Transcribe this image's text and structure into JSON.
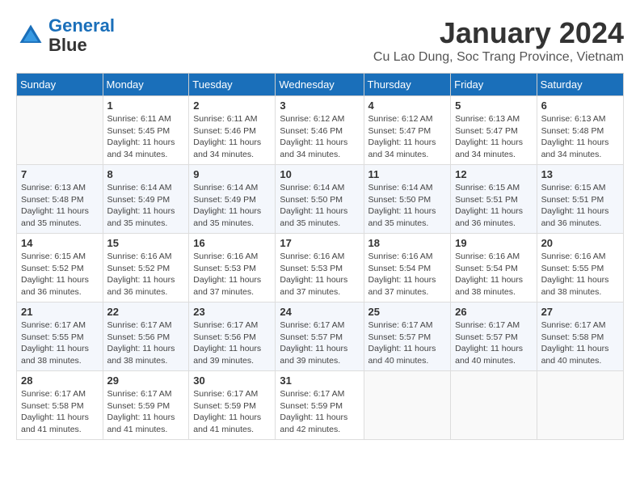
{
  "header": {
    "logo_line1": "General",
    "logo_line2": "Blue",
    "month": "January 2024",
    "location": "Cu Lao Dung, Soc Trang Province, Vietnam"
  },
  "weekdays": [
    "Sunday",
    "Monday",
    "Tuesday",
    "Wednesday",
    "Thursday",
    "Friday",
    "Saturday"
  ],
  "weeks": [
    [
      {
        "day": "",
        "info": ""
      },
      {
        "day": "1",
        "info": "Sunrise: 6:11 AM\nSunset: 5:45 PM\nDaylight: 11 hours\nand 34 minutes."
      },
      {
        "day": "2",
        "info": "Sunrise: 6:11 AM\nSunset: 5:46 PM\nDaylight: 11 hours\nand 34 minutes."
      },
      {
        "day": "3",
        "info": "Sunrise: 6:12 AM\nSunset: 5:46 PM\nDaylight: 11 hours\nand 34 minutes."
      },
      {
        "day": "4",
        "info": "Sunrise: 6:12 AM\nSunset: 5:47 PM\nDaylight: 11 hours\nand 34 minutes."
      },
      {
        "day": "5",
        "info": "Sunrise: 6:13 AM\nSunset: 5:47 PM\nDaylight: 11 hours\nand 34 minutes."
      },
      {
        "day": "6",
        "info": "Sunrise: 6:13 AM\nSunset: 5:48 PM\nDaylight: 11 hours\nand 34 minutes."
      }
    ],
    [
      {
        "day": "7",
        "info": "Sunrise: 6:13 AM\nSunset: 5:48 PM\nDaylight: 11 hours\nand 35 minutes."
      },
      {
        "day": "8",
        "info": "Sunrise: 6:14 AM\nSunset: 5:49 PM\nDaylight: 11 hours\nand 35 minutes."
      },
      {
        "day": "9",
        "info": "Sunrise: 6:14 AM\nSunset: 5:49 PM\nDaylight: 11 hours\nand 35 minutes."
      },
      {
        "day": "10",
        "info": "Sunrise: 6:14 AM\nSunset: 5:50 PM\nDaylight: 11 hours\nand 35 minutes."
      },
      {
        "day": "11",
        "info": "Sunrise: 6:14 AM\nSunset: 5:50 PM\nDaylight: 11 hours\nand 35 minutes."
      },
      {
        "day": "12",
        "info": "Sunrise: 6:15 AM\nSunset: 5:51 PM\nDaylight: 11 hours\nand 36 minutes."
      },
      {
        "day": "13",
        "info": "Sunrise: 6:15 AM\nSunset: 5:51 PM\nDaylight: 11 hours\nand 36 minutes."
      }
    ],
    [
      {
        "day": "14",
        "info": "Sunrise: 6:15 AM\nSunset: 5:52 PM\nDaylight: 11 hours\nand 36 minutes."
      },
      {
        "day": "15",
        "info": "Sunrise: 6:16 AM\nSunset: 5:52 PM\nDaylight: 11 hours\nand 36 minutes."
      },
      {
        "day": "16",
        "info": "Sunrise: 6:16 AM\nSunset: 5:53 PM\nDaylight: 11 hours\nand 37 minutes."
      },
      {
        "day": "17",
        "info": "Sunrise: 6:16 AM\nSunset: 5:53 PM\nDaylight: 11 hours\nand 37 minutes."
      },
      {
        "day": "18",
        "info": "Sunrise: 6:16 AM\nSunset: 5:54 PM\nDaylight: 11 hours\nand 37 minutes."
      },
      {
        "day": "19",
        "info": "Sunrise: 6:16 AM\nSunset: 5:54 PM\nDaylight: 11 hours\nand 38 minutes."
      },
      {
        "day": "20",
        "info": "Sunrise: 6:16 AM\nSunset: 5:55 PM\nDaylight: 11 hours\nand 38 minutes."
      }
    ],
    [
      {
        "day": "21",
        "info": "Sunrise: 6:17 AM\nSunset: 5:55 PM\nDaylight: 11 hours\nand 38 minutes."
      },
      {
        "day": "22",
        "info": "Sunrise: 6:17 AM\nSunset: 5:56 PM\nDaylight: 11 hours\nand 38 minutes."
      },
      {
        "day": "23",
        "info": "Sunrise: 6:17 AM\nSunset: 5:56 PM\nDaylight: 11 hours\nand 39 minutes."
      },
      {
        "day": "24",
        "info": "Sunrise: 6:17 AM\nSunset: 5:57 PM\nDaylight: 11 hours\nand 39 minutes."
      },
      {
        "day": "25",
        "info": "Sunrise: 6:17 AM\nSunset: 5:57 PM\nDaylight: 11 hours\nand 40 minutes."
      },
      {
        "day": "26",
        "info": "Sunrise: 6:17 AM\nSunset: 5:57 PM\nDaylight: 11 hours\nand 40 minutes."
      },
      {
        "day": "27",
        "info": "Sunrise: 6:17 AM\nSunset: 5:58 PM\nDaylight: 11 hours\nand 40 minutes."
      }
    ],
    [
      {
        "day": "28",
        "info": "Sunrise: 6:17 AM\nSunset: 5:58 PM\nDaylight: 11 hours\nand 41 minutes."
      },
      {
        "day": "29",
        "info": "Sunrise: 6:17 AM\nSunset: 5:59 PM\nDaylight: 11 hours\nand 41 minutes."
      },
      {
        "day": "30",
        "info": "Sunrise: 6:17 AM\nSunset: 5:59 PM\nDaylight: 11 hours\nand 41 minutes."
      },
      {
        "day": "31",
        "info": "Sunrise: 6:17 AM\nSunset: 5:59 PM\nDaylight: 11 hours\nand 42 minutes."
      },
      {
        "day": "",
        "info": ""
      },
      {
        "day": "",
        "info": ""
      },
      {
        "day": "",
        "info": ""
      }
    ]
  ]
}
